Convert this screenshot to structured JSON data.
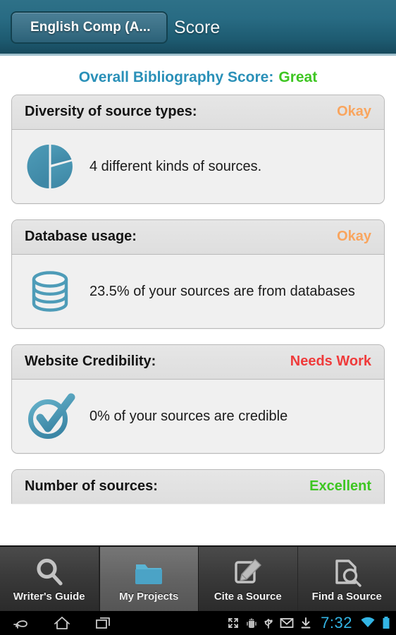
{
  "actionbar": {
    "breadcrumb_label": "English Comp (A...",
    "title": "Score"
  },
  "overall": {
    "label": "Overall Bibliography Score:",
    "value": "Great",
    "label_color": "#2a90b8",
    "value_color": "#3ec622"
  },
  "cards": [
    {
      "title": "Diversity of source types:",
      "score": "Okay",
      "score_color": "#f9a55e",
      "icon": "pie-chart-icon",
      "text": "4 different kinds of sources."
    },
    {
      "title": "Database usage:",
      "score": "Okay",
      "score_color": "#f9a55e",
      "icon": "database-icon",
      "text": "23.5% of your sources are from databases"
    },
    {
      "title": "Website Credibility:",
      "score": "Needs Work",
      "score_color": "#ef3b3b",
      "icon": "check-circle-icon",
      "text": "0% of your sources are credible"
    },
    {
      "title": "Number of sources:",
      "score": "Excellent",
      "score_color": "#3ec622",
      "icon": "",
      "text": ""
    }
  ],
  "tabbar": {
    "items": [
      {
        "label": "Writer's Guide",
        "icon": "magnifier-icon",
        "selected": false
      },
      {
        "label": "My Projects",
        "icon": "folder-icon",
        "selected": true
      },
      {
        "label": "Cite a Source",
        "icon": "pencil-note-icon",
        "selected": false
      },
      {
        "label": "Find a Source",
        "icon": "document-search-icon",
        "selected": false
      }
    ]
  },
  "systembar": {
    "back_icon": "back-arrow-icon",
    "home_icon": "home-icon",
    "recents_icon": "recent-apps-icon",
    "status_icons": [
      "fullscreen-icon",
      "android-debug-icon",
      "usb-icon",
      "mail-icon",
      "download-icon"
    ],
    "clock": "7:32",
    "wifi_icon": "wifi-icon",
    "battery_icon": "battery-icon",
    "accent_color": "#33b5e5"
  }
}
